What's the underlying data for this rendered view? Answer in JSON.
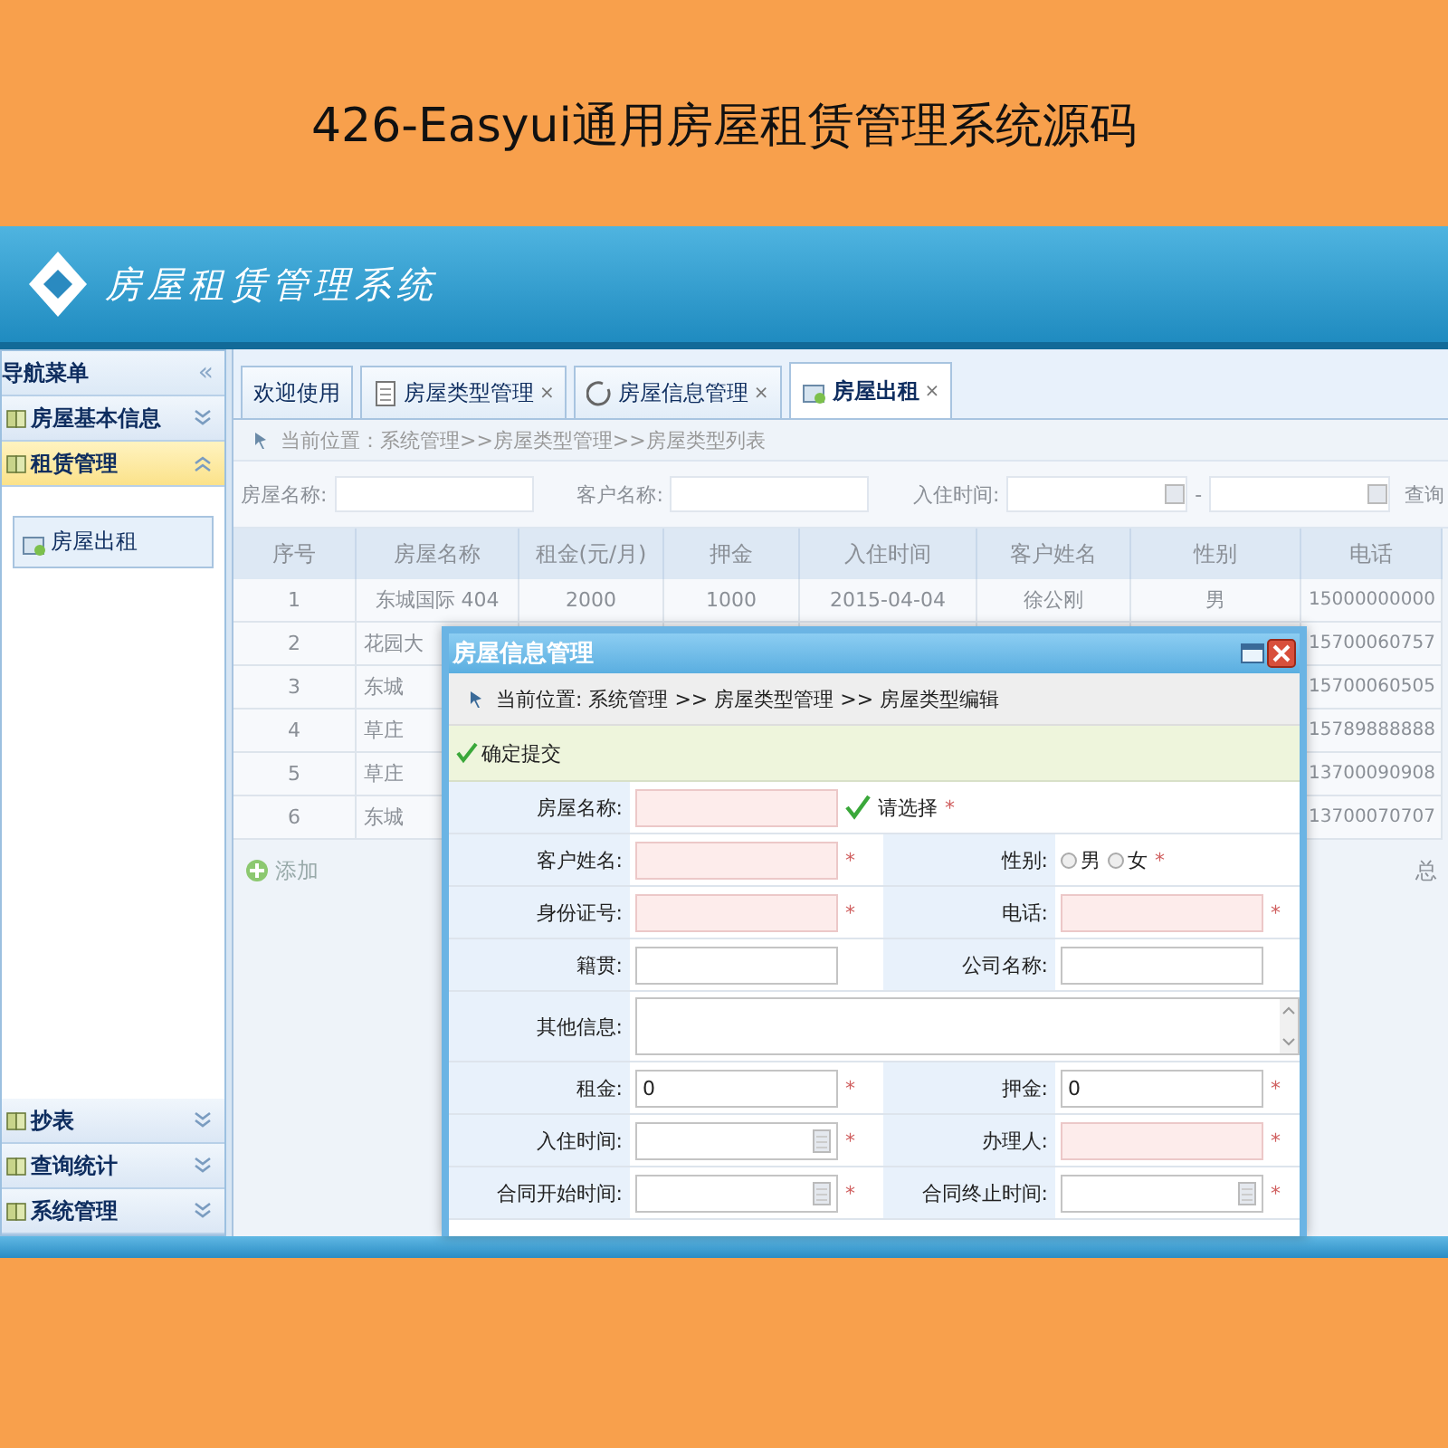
{
  "banner_title": "426-Easyui通用房屋租赁管理系统源码",
  "header": {
    "app_name": "房屋租赁管理系统"
  },
  "sidebar": {
    "title": "导航菜单",
    "collapse_glyph": "«",
    "panels": [
      {
        "label": "房屋基本信息",
        "expanded": false
      },
      {
        "label": "租赁管理",
        "expanded": true,
        "items": [
          {
            "label": "房屋出租",
            "selected": true
          }
        ]
      },
      {
        "label": "抄表",
        "expanded": false
      },
      {
        "label": "查询统计",
        "expanded": false
      },
      {
        "label": "系统管理",
        "expanded": false
      }
    ]
  },
  "tab_bar": {
    "tabs": [
      {
        "label": "欢迎使用",
        "selected": false
      },
      {
        "label": "房屋类型管理",
        "close": "×",
        "selected": false
      },
      {
        "label": "房屋信息管理",
        "close": "×",
        "selected": false
      },
      {
        "label": "房屋出租",
        "close": "×",
        "selected": true
      }
    ]
  },
  "breadcrumb": "当前位置：系统管理>>房屋类型管理>>房屋类型列表",
  "search": {
    "fields": [
      {
        "label": "房屋名称:",
        "kind": "text"
      },
      {
        "label": "客户名称:",
        "kind": "text"
      },
      {
        "label": "入住时间:",
        "kind": "daterange",
        "separator": "-"
      }
    ],
    "button": "查询"
  },
  "table": {
    "columns": [
      "序号",
      "房屋名称",
      "租金(元/月)",
      "押金",
      "入住时间",
      "客户姓名",
      "性别",
      "电话"
    ],
    "rows": [
      {
        "no": "1",
        "name": "东城国际 404",
        "rent": "2000",
        "deposit": "1000",
        "date": "2015-04-04",
        "customer": "徐公刚",
        "gender": "男",
        "phone": "15000000000"
      },
      {
        "no": "2",
        "name": "花园大",
        "phone": "15700060757"
      },
      {
        "no": "3",
        "name": "东城",
        "phone": "15700060505"
      },
      {
        "no": "4",
        "name": "草庄",
        "phone": "15789888888"
      },
      {
        "no": "5",
        "name": "草庄",
        "phone": "13700090908"
      },
      {
        "no": "6",
        "name": "东城",
        "phone": "13700070707"
      }
    ]
  },
  "add_link": "添加",
  "pager_text": "总",
  "dialog": {
    "title": "房屋信息管理",
    "breadcrumb": "当前位置: 系统管理 >> 房屋类型管理 >> 房屋类型编辑",
    "submit": "确定提交",
    "rows": [
      {
        "kind": "wide",
        "cells": [
          {
            "label": "房屋名称:",
            "field": {
              "kind": "combo",
              "invalid": true,
              "hint": "请选择"
            },
            "mark": "*"
          }
        ]
      },
      {
        "kind": "pair",
        "cells": [
          {
            "label": "客户姓名:",
            "field": {
              "kind": "text",
              "invalid": true
            },
            "mark": "*"
          },
          {
            "label": "性别:",
            "field": {
              "kind": "radio",
              "options": [
                {
                  "label": "男",
                  "selected": false
                },
                {
                  "label": "女",
                  "selected": false
                }
              ]
            },
            "mark": "*"
          }
        ]
      },
      {
        "kind": "pair",
        "cells": [
          {
            "label": "身份证号:",
            "field": {
              "kind": "text",
              "invalid": true
            },
            "mark": "*"
          },
          {
            "label": "电话:",
            "field": {
              "kind": "text",
              "invalid": true
            },
            "mark": "*"
          }
        ]
      },
      {
        "kind": "pair",
        "cells": [
          {
            "label": "籍贯:",
            "field": {
              "kind": "text",
              "invalid": false
            }
          },
          {
            "label": "公司名称:",
            "field": {
              "kind": "text",
              "invalid": false
            }
          }
        ]
      },
      {
        "kind": "wide",
        "cells": [
          {
            "label": "其他信息:",
            "field": {
              "kind": "textarea",
              "invalid": false
            }
          }
        ]
      },
      {
        "kind": "pair",
        "cells": [
          {
            "label": "租金:",
            "field": {
              "kind": "text",
              "invalid": false,
              "value": "0"
            },
            "mark": "*"
          },
          {
            "label": "押金:",
            "field": {
              "kind": "text",
              "invalid": false,
              "value": "0"
            },
            "mark": "*"
          }
        ]
      },
      {
        "kind": "pair",
        "cells": [
          {
            "label": "入住时间:",
            "field": {
              "kind": "date",
              "invalid": false
            },
            "mark": "*"
          },
          {
            "label": "办理人:",
            "field": {
              "kind": "text",
              "invalid": true
            },
            "mark": "*"
          }
        ]
      },
      {
        "kind": "pair",
        "cells": [
          {
            "label": "合同开始时间:",
            "field": {
              "kind": "date",
              "invalid": false
            },
            "mark": "*"
          },
          {
            "label": "合同终止时间:",
            "field": {
              "kind": "date",
              "invalid": false
            },
            "mark": "*"
          }
        ]
      }
    ]
  }
}
